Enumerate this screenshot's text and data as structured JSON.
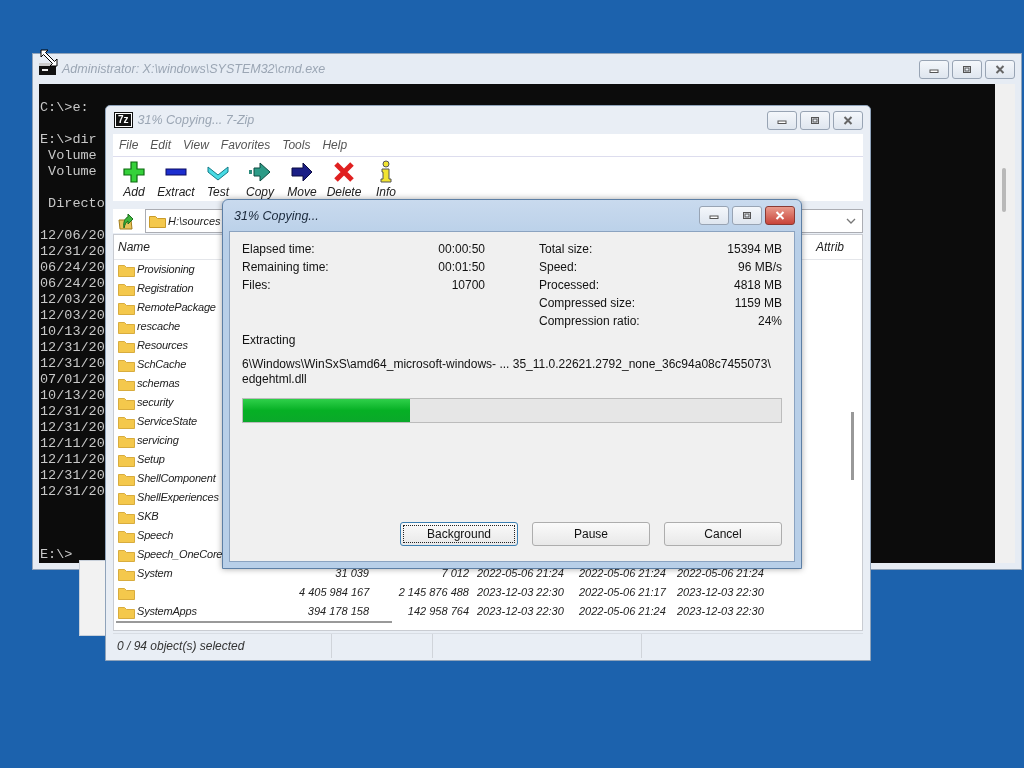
{
  "console_window": {
    "title": "Administrator: X:\\windows\\SYSTEM32\\cmd.exe",
    "active": false,
    "line_groups": [
      [
        "C:\\>e:"
      ],
      [
        "E:\\>dir",
        " Volume",
        " Volume"
      ],
      [
        " Directo"
      ],
      [
        "12/06/20",
        "12/31/20",
        "06/24/20",
        "06/24/20",
        "12/03/20",
        "12/03/20",
        "10/13/20",
        "12/31/20",
        "12/31/20",
        "07/01/20",
        "10/13/20",
        "12/31/20",
        "12/31/20",
        "12/11/20",
        "12/11/20",
        "12/31/20",
        "12/31/20"
      ]
    ],
    "prompt": "E:\\>"
  },
  "zip_window": {
    "logo": "7z",
    "title": "31% Copying... 7-Zip",
    "active": false,
    "menu": [
      "File",
      "Edit",
      "View",
      "Favorites",
      "Tools",
      "Help"
    ],
    "toolbar": [
      {
        "kind": "add",
        "label": "Add"
      },
      {
        "kind": "extract",
        "label": "Extract"
      },
      {
        "kind": "test",
        "label": "Test"
      },
      {
        "kind": "copy",
        "label": "Copy"
      },
      {
        "kind": "move",
        "label": "Move"
      },
      {
        "kind": "delete",
        "label": "Delete"
      },
      {
        "kind": "info",
        "label": "Info"
      }
    ],
    "address": {
      "value": "H:\\sources"
    },
    "table": {
      "columns": [
        {
          "label": "Name"
        },
        {
          "label": "Attrib"
        }
      ],
      "rows": [
        {
          "name": "Provisioning"
        },
        {
          "name": "Registration"
        },
        {
          "name": "RemotePackage"
        },
        {
          "name": "rescache"
        },
        {
          "name": "Resources"
        },
        {
          "name": "SchCache"
        },
        {
          "name": "schemas"
        },
        {
          "name": "security"
        },
        {
          "name": "ServiceState"
        },
        {
          "name": "servicing"
        },
        {
          "name": "Setup"
        },
        {
          "name": "ShellComponent"
        },
        {
          "name": "ShellExperiences"
        },
        {
          "name": "SKB"
        },
        {
          "name": "Speech"
        },
        {
          "name": "Speech_OneCore"
        },
        {
          "name": "System",
          "size": "31 039",
          "packed_size": "7 012",
          "modified": "2022-05-06 21:24",
          "created": "2022-05-06 21:24",
          "accessed": "2022-05-06 21:24"
        },
        {
          "size": "4 405 984 167",
          "packed_size": "2 145 876 488",
          "modified": "2023-12-03 22:30",
          "created": "2022-05-06 21:17",
          "accessed": "2023-12-03 22:30"
        },
        {
          "name": "SystemApps",
          "size": "394 178 158",
          "packed_size": "142 958 764",
          "modified": "2023-12-03 22:30",
          "created": "2022-05-06 21:24",
          "accessed": "2023-12-03 22:30"
        }
      ]
    },
    "status_bar": [
      "0 / 94 object(s) selected"
    ]
  },
  "progress_dialog": {
    "title": "31% Copying...",
    "active": true,
    "left_stats": [
      {
        "label": "Elapsed time:",
        "value": "00:00:50"
      },
      {
        "label": "Remaining time:",
        "value": "00:01:50"
      },
      {
        "label": "Files:",
        "value": "10700"
      }
    ],
    "right_stats": [
      {
        "label": "Total size:",
        "value": "15394 MB"
      },
      {
        "label": "Speed:",
        "value": "96 MB/s"
      },
      {
        "label": "Processed:",
        "value": "4818 MB"
      },
      {
        "label": "Compressed size:",
        "value": "1159 MB"
      },
      {
        "label": "Compression ratio:",
        "value": "24%"
      }
    ],
    "operation": "Extracting",
    "current_file_lines": [
      "6\\Windows\\WinSxS\\amd64_microsoft-windows- ... 35_11.0.22621.2792_none_36c94a08c7455073\\",
      "edgehtml.dll"
    ],
    "progress": {
      "level": 0.31
    },
    "buttons": [
      {
        "label": "Background",
        "focused": true
      },
      {
        "label": "Pause",
        "focused": false
      },
      {
        "label": "Cancel",
        "focused": false
      }
    ]
  }
}
